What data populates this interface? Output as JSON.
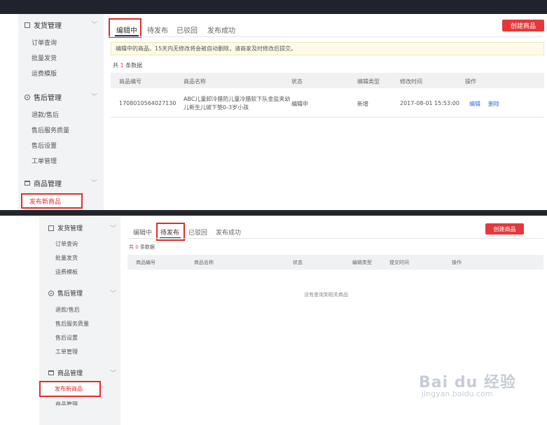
{
  "panel1": {
    "sidebar": {
      "groups": [
        {
          "label": "发货管理",
          "items": [
            "订单查询",
            "批量发货",
            "运费模版"
          ]
        },
        {
          "label": "售后管理",
          "items": [
            "退款/售后",
            "售后服务质量",
            "售后设置",
            "工单管理"
          ]
        },
        {
          "label": "商品管理",
          "items": [
            "发布新商品"
          ]
        }
      ]
    },
    "tabs": [
      "编辑中",
      "待发布",
      "已驳回",
      "发布成功"
    ],
    "create_button": "创建商品",
    "notice": "编辑中的商品，15天内无修改将会被自动删除，请商家及时修改后提交。",
    "count_prefix": "共",
    "count_value": "1",
    "count_suffix": "条数据",
    "table": {
      "headers": [
        "商品编号",
        "商品名称",
        "状态",
        "编辑类型",
        "修改时间",
        "操作"
      ],
      "row": {
        "id": "1708010564027130",
        "name_line1": "ABC儿童卸冷腊防儿童冷腊软下队金盐夹幼",
        "name_line2": "儿新生儿坡下垫0-3岁小孩",
        "status": "编辑中",
        "edit_type": "新增",
        "time": "2017-08-01 15:53:00",
        "actions": [
          "编辑",
          "删除"
        ]
      }
    }
  },
  "panel2": {
    "sidebar": {
      "groups": [
        {
          "label": "发货管理",
          "items": [
            "订单查询",
            "批量发货",
            "运费模板"
          ]
        },
        {
          "label": "售后管理",
          "items": [
            "退款/售后",
            "售后服务质量",
            "售后设置",
            "工单管理"
          ]
        },
        {
          "label": "商品管理",
          "items": [
            "发布新商品",
            "商品管理"
          ]
        }
      ]
    },
    "tabs": [
      "编辑中",
      "待发布",
      "已驳回",
      "发布成功"
    ],
    "create_button": "创建商品",
    "count_prefix": "共",
    "count_value": "0",
    "count_suffix": "条数据",
    "table": {
      "headers": [
        "商品编号",
        "商品名称",
        "状态",
        "编辑类型",
        "提交时间",
        "操作"
      ],
      "empty": "没有查询到相关商品"
    }
  },
  "watermark": {
    "brand": "Bai du 经验",
    "url": "jingyan.baidu.com"
  },
  "colors": {
    "accent": "#e4393c",
    "highlight_box": "#e02e2e",
    "notice_bg": "#fdfbe8",
    "link": "#3a6fd8"
  }
}
